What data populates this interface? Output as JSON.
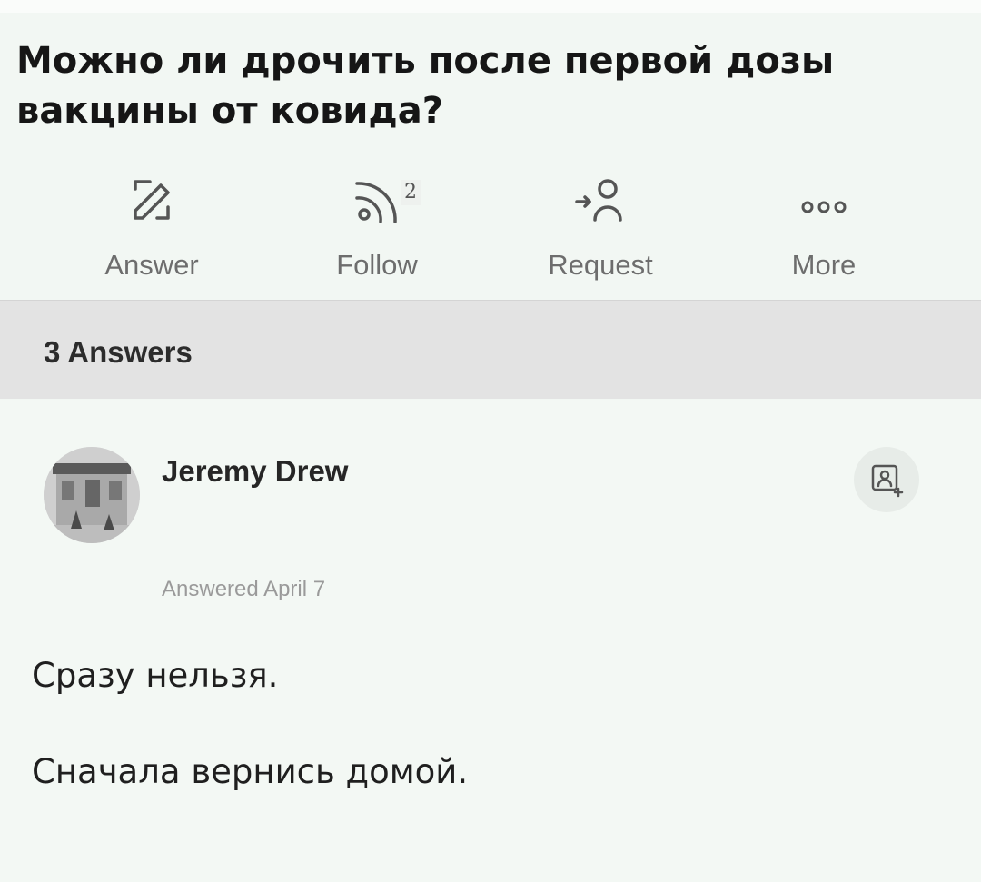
{
  "question": {
    "title": "Можно ли дрочить после первой дозы вакцины от ковида?"
  },
  "actions": [
    {
      "label": "Answer",
      "icon": "pencil-edit-icon"
    },
    {
      "label": "Follow",
      "icon": "rss-feed-icon",
      "count": "2"
    },
    {
      "label": "Request",
      "icon": "request-user-icon"
    },
    {
      "label": "More",
      "icon": "more-dots-icon"
    }
  ],
  "answers_header": {
    "count_label": "3 Answers"
  },
  "answer": {
    "author": "Jeremy Drew",
    "date": "Answered April 7",
    "lines": [
      "Сразу нельзя.",
      "Сначала вернись домой."
    ],
    "follow_icon": "follow-user-icon",
    "avatar_icon": "avatar-image"
  },
  "colors": {
    "background": "#f2f7f3",
    "answers_bar": "#e3e3e3",
    "muted_text": "#6d6d6d"
  }
}
